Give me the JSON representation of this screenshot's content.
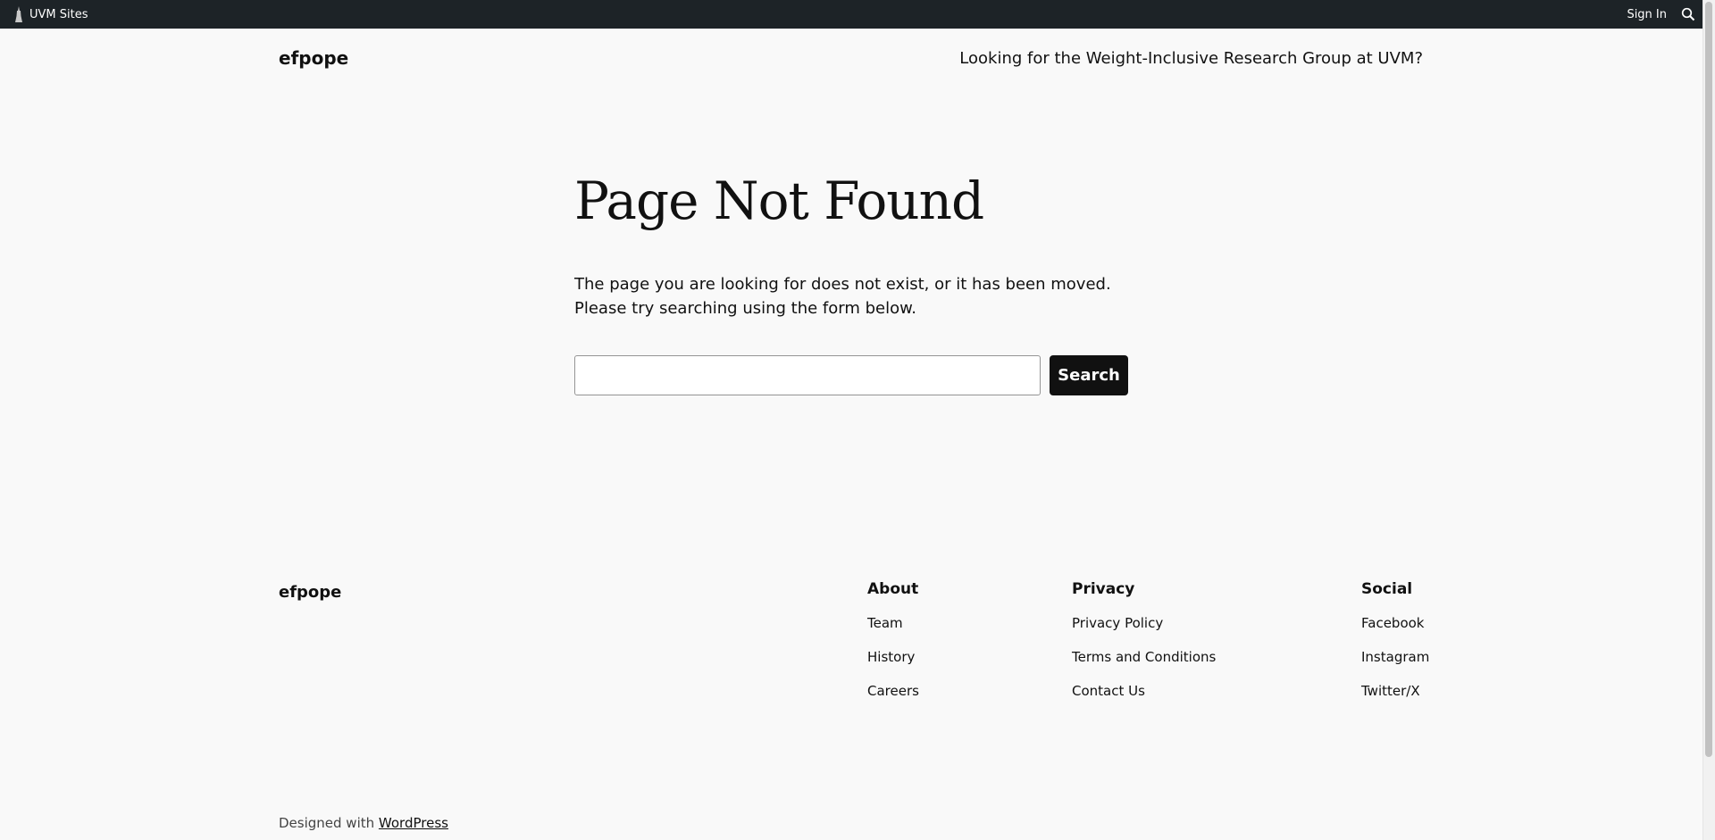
{
  "admin_bar": {
    "sites_label": "UVM Sites",
    "sign_in_label": "Sign In",
    "search_icon": "search-icon",
    "logo_icon": "uvm-tower-icon",
    "background_color": "#1d2327"
  },
  "header": {
    "site_title": "efpope",
    "nav_link": "Looking for the Weight-Inclusive Research Group at UVM?"
  },
  "main": {
    "title": "Page Not Found",
    "message": "The page you are looking for does not exist, or it has been moved. Please try searching using the form below.",
    "search_value": "",
    "search_button": "Search"
  },
  "footer": {
    "site_title": "efpope",
    "columns": [
      {
        "heading": "About",
        "links": [
          "Team",
          "History",
          "Careers"
        ]
      },
      {
        "heading": "Privacy",
        "links": [
          "Privacy Policy",
          "Terms and Conditions",
          "Contact Us"
        ]
      },
      {
        "heading": "Social",
        "links": [
          "Facebook",
          "Instagram",
          "Twitter/X"
        ]
      }
    ],
    "credit_prefix": "Designed with",
    "credit_link": "WordPress"
  },
  "colors": {
    "page_background": "#f9f9f9",
    "text": "#111111",
    "button_background": "#111111"
  }
}
